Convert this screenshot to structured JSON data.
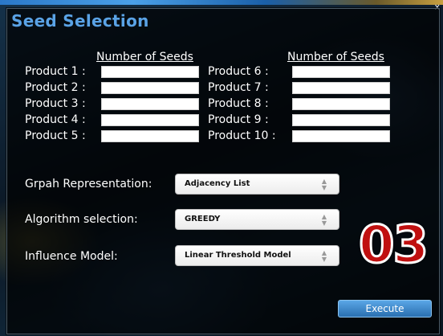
{
  "window": {
    "title": "Seed Selection",
    "close_label": "x"
  },
  "columns": {
    "left_header": "Number of Seeds",
    "right_header": "Number of Seeds"
  },
  "products_left": [
    {
      "label": "Product 1 :",
      "value": ""
    },
    {
      "label": "Product 2 :",
      "value": ""
    },
    {
      "label": "Product 3 :",
      "value": ""
    },
    {
      "label": "Product 4 :",
      "value": ""
    },
    {
      "label": "Product 5 :",
      "value": ""
    }
  ],
  "products_right": [
    {
      "label": "Product 6 :",
      "value": ""
    },
    {
      "label": "Product 7 :",
      "value": ""
    },
    {
      "label": "Product 8 :",
      "value": ""
    },
    {
      "label": "Product 9 :",
      "value": ""
    },
    {
      "label": "Product 10 :",
      "value": ""
    }
  ],
  "graph_representation": {
    "label": "Grpah Representation:",
    "selected": "Adjacency List"
  },
  "algorithm_selection": {
    "label": "Algorithm selection:",
    "selected": "GREEDY"
  },
  "influence_model": {
    "label": "Influence Model:",
    "selected": "Linear Threshold Model"
  },
  "overlay_badge": "03",
  "execute_label": "Execute",
  "colors": {
    "title": "#5aa3e6",
    "badge": "#c01010",
    "execute": "#2a6fb0"
  }
}
